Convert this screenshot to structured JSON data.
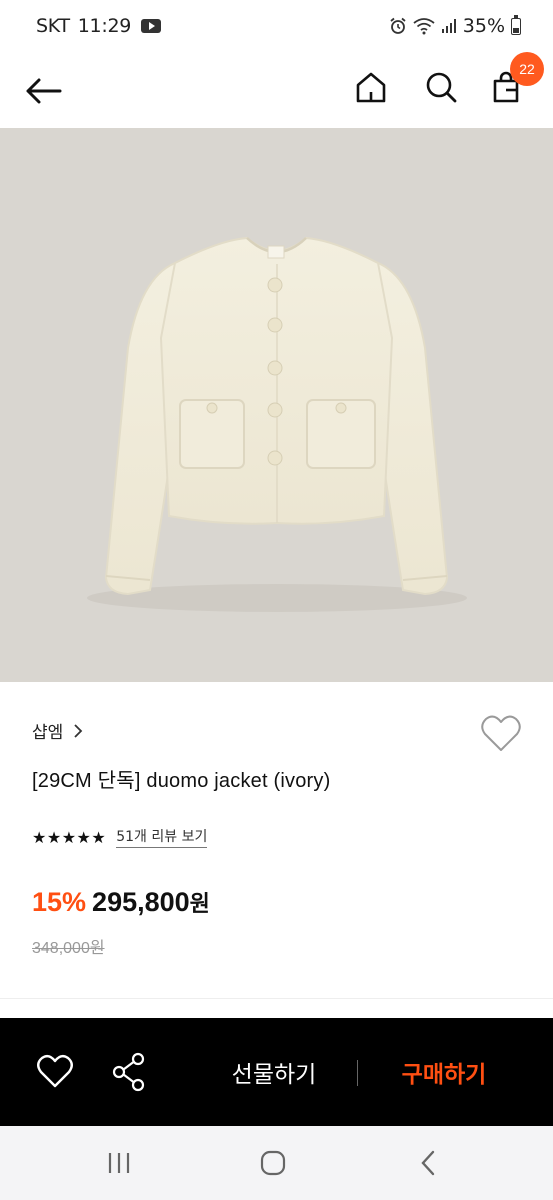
{
  "status_bar": {
    "carrier": "SKT",
    "time": "11:29",
    "battery": "35%"
  },
  "nav": {
    "cart_count": "22"
  },
  "product": {
    "brand": "샵엠",
    "brand_chevron": "›",
    "title": "[29CM 단독] duomo jacket (ivory)",
    "stars": "★★★★★",
    "rating_value": 5,
    "review_link": "51개 리뷰 보기",
    "discount": "15%",
    "price": "295,800",
    "currency": "원",
    "original_price": "348,000원"
  },
  "actions": {
    "gift_label": "선물하기",
    "buy_label": "구매하기"
  },
  "colors": {
    "accent": "#ff4f12",
    "badge": "#ff5a1f",
    "image_bg": "#d9d6d0",
    "action_bar_bg": "#000000"
  }
}
